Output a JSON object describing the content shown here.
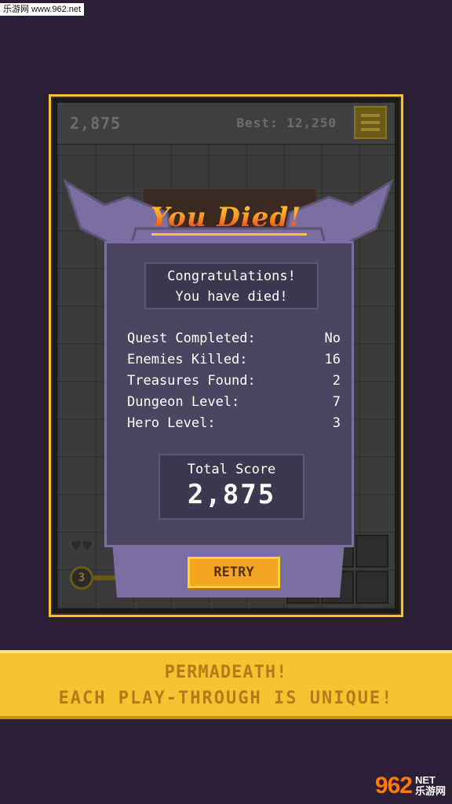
{
  "watermark": {
    "top_text": "乐游网 www.962.net",
    "logo_text": "962",
    "logo_net": "NET",
    "logo_sub": "乐游网"
  },
  "hud": {
    "score": "2,875",
    "best": "Best: 12,250"
  },
  "death_screen": {
    "title": "You Died!",
    "congrats_line1": "Congratulations!",
    "congrats_line2": "You have died!",
    "stats": [
      {
        "label": "Quest Completed:",
        "value": "No"
      },
      {
        "label": "Enemies Killed:",
        "value": "16"
      },
      {
        "label": "Treasures Found:",
        "value": "2"
      },
      {
        "label": "Dungeon Level:",
        "value": "7"
      },
      {
        "label": "Hero Level:",
        "value": "3"
      }
    ],
    "total_score_label": "Total Score",
    "total_score_value": "2,875",
    "retry_label": "RETRY"
  },
  "bottom_hud": {
    "hearts": "♥♥",
    "hero_level_badge": "3"
  },
  "banner": {
    "line1": "PERMADEATH!",
    "line2": "EACH PLAY-THROUGH IS UNIQUE!"
  },
  "colors": {
    "frame_gold": "#f4c430",
    "card_purple": "#4a4560",
    "retry_orange": "#f4a620",
    "background": "#2d1f38"
  }
}
